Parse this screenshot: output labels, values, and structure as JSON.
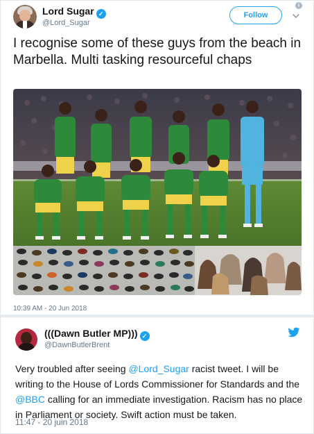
{
  "tweet1": {
    "author_name": "Lord Sugar",
    "author_handle": "@Lord_Sugar",
    "follow_label": "Follow",
    "info_symbol": "i",
    "text": "I recognise some of these guys from the beach in Marbella. Multi tasking resourceful chaps",
    "timestamp": "10:39 AM - 20 Jun 2018"
  },
  "tweet2": {
    "author_name": "(((Dawn Butler MP)))",
    "author_handle": "@DawnButlerBrent",
    "text_part1": "Very troubled after seeing ",
    "mention1": "@Lord_Sugar",
    "text_part2": " racist tweet. I will be writing to the House of Lords Commissioner for Standards and the ",
    "mention2": "@BBC",
    "text_part3": " calling for an immediate investigation. Racism has no place in Parliament or society. Swift action must be taken.",
    "timestamp": "11:47 - 20 juin 2018"
  },
  "icons": {
    "verified": "verified-badge-icon",
    "info": "info-icon",
    "caret": "chevron-down-icon",
    "twitter": "twitter-bird-icon"
  },
  "colors": {
    "accent": "#1da1f2",
    "secondary_text": "#657786",
    "primary_text": "#14171a",
    "border": "#e1e8ed"
  }
}
